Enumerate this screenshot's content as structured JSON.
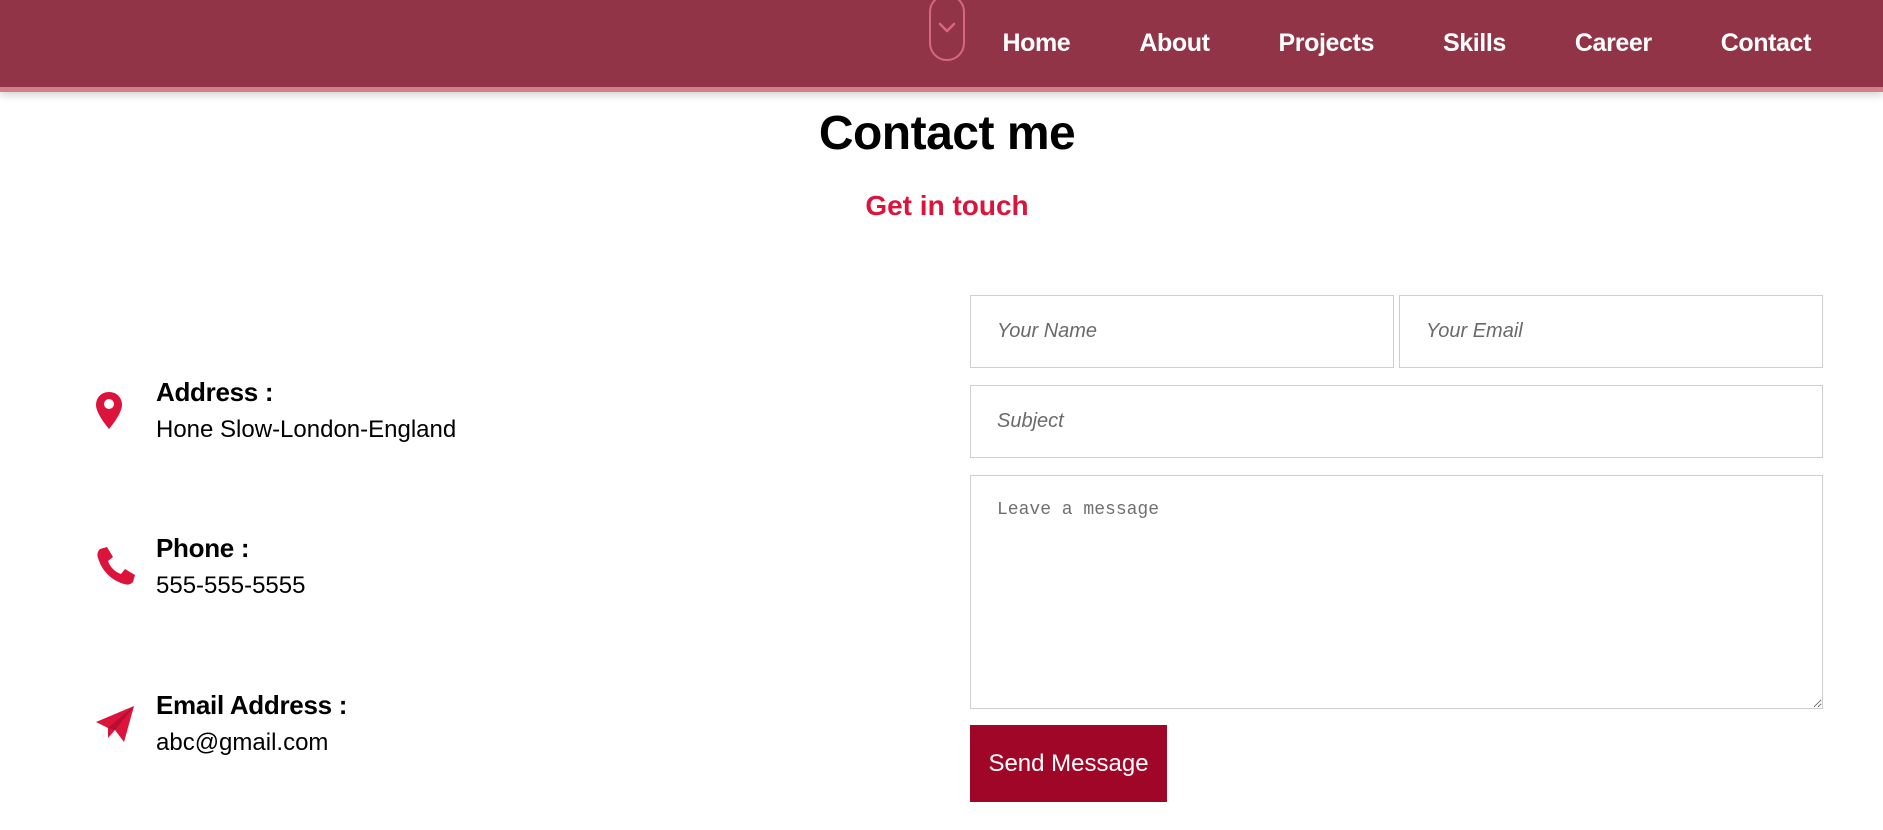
{
  "nav": {
    "scroll_icon": "chevron-down-icon",
    "links": [
      {
        "label": "Home"
      },
      {
        "label": "About"
      },
      {
        "label": "Projects"
      },
      {
        "label": "Skills"
      },
      {
        "label": "Career"
      },
      {
        "label": "Contact"
      }
    ]
  },
  "header": {
    "title": "Contact me",
    "subtitle": "Get in touch"
  },
  "contact_info": {
    "address": {
      "icon": "location-pin-icon",
      "label": "Address :",
      "value": "Hone Slow-London-England"
    },
    "phone": {
      "icon": "phone-icon",
      "label": "Phone :",
      "value": "555-555-5555"
    },
    "email": {
      "icon": "paper-plane-icon",
      "label": "Email Address :",
      "value": "abc@gmail.com"
    }
  },
  "form": {
    "name_placeholder": "Your Name",
    "email_placeholder": "Your Email",
    "subject_placeholder": "Subject",
    "message_placeholder": "Leave a message",
    "submit_label": "Send Message"
  },
  "colors": {
    "navbar_bg": "#923447",
    "accent": "#dc143c",
    "button_bg": "#a00628"
  }
}
